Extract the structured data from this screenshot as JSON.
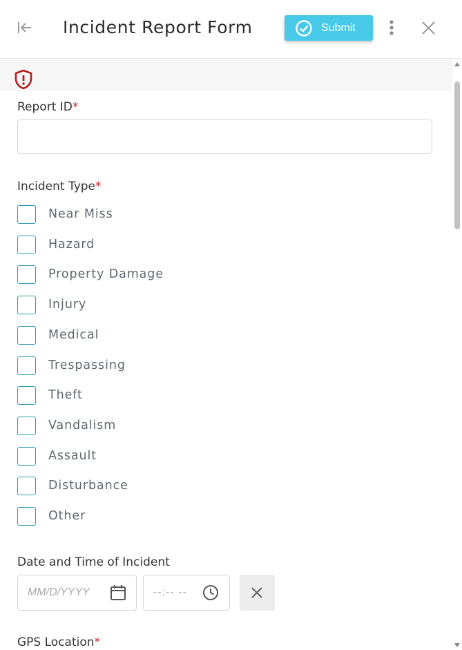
{
  "header": {
    "title": "Incident Report Form",
    "submit_label": "Submit",
    "back_icon": "collapse-left-icon",
    "more_icon": "more-vertical-icon",
    "close_icon": "close-icon"
  },
  "banner": {
    "icon": "shield-alert-icon",
    "icon_color": "#b71c1c"
  },
  "form": {
    "report_id": {
      "label": "Report ID",
      "required_mark": "*",
      "value": ""
    },
    "incident_type": {
      "label": "Incident Type",
      "required_mark": "*",
      "options": [
        "Near Miss",
        "Hazard",
        "Property Damage",
        "Injury",
        "Medical",
        "Trespassing",
        "Theft",
        "Vandalism",
        "Assault",
        "Disturbance",
        "Other"
      ]
    },
    "date_time": {
      "label": "Date and Time of Incident",
      "date_placeholder": "MM/D/YYYY",
      "time_placeholder": "--:-- --"
    },
    "gps": {
      "label": "GPS Location",
      "required_mark": "*"
    }
  },
  "colors": {
    "accent": "#49c9e8",
    "checkbox_border": "#2c9cb0",
    "required": "#c0262c"
  }
}
